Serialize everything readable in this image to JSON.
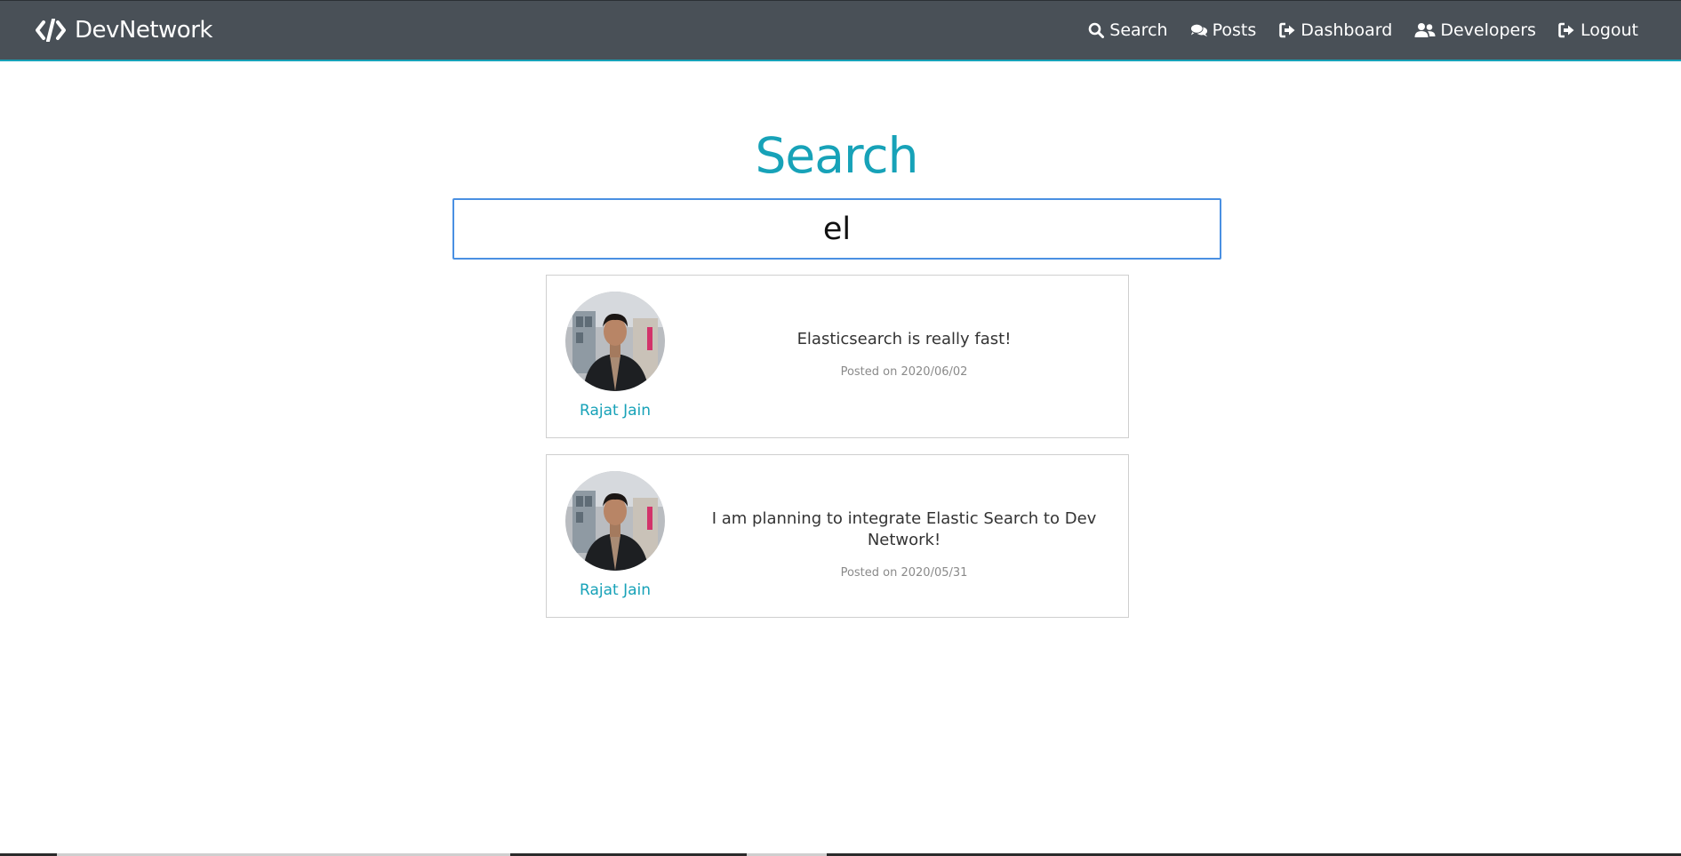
{
  "nav": {
    "brand": "DevNetwork",
    "links": [
      {
        "label": "Search",
        "icon": "search-icon"
      },
      {
        "label": "Posts",
        "icon": "comments-icon"
      },
      {
        "label": "Dashboard",
        "icon": "sign-out-icon"
      },
      {
        "label": "Developers",
        "icon": "users-icon"
      },
      {
        "label": "Logout",
        "icon": "sign-out-icon"
      }
    ]
  },
  "main": {
    "title": "Search",
    "search": {
      "value": "el",
      "placeholder": ""
    }
  },
  "posts": [
    {
      "author": "Rajat Jain",
      "text": "Elasticsearch is really fast!",
      "date": "Posted on 2020/06/02"
    },
    {
      "author": "Rajat Jain",
      "text": "I am planning to integrate Elastic Search to Dev Network!",
      "date": "Posted on 2020/05/31"
    }
  ],
  "colors": {
    "navbar": "#495057",
    "accent": "#17a2b8",
    "input_focus": "#4a90e2"
  }
}
